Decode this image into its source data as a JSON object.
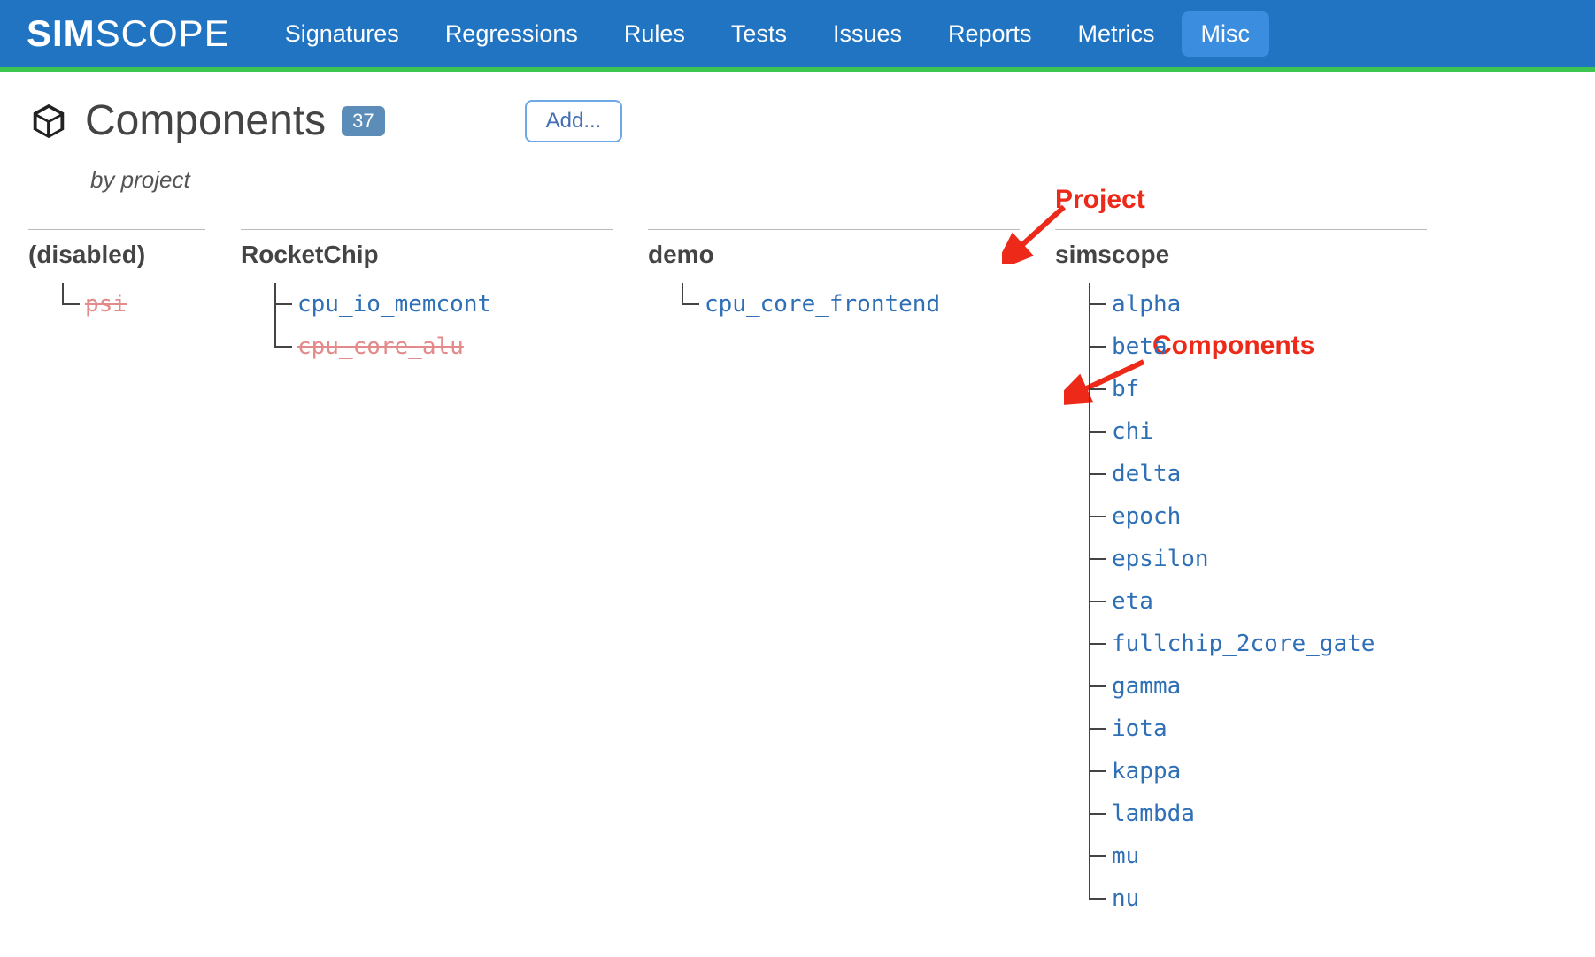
{
  "brand": {
    "part1": "SIM",
    "part2": "SCOPE"
  },
  "nav": [
    {
      "label": "Signatures",
      "active": false
    },
    {
      "label": "Regressions",
      "active": false
    },
    {
      "label": "Rules",
      "active": false
    },
    {
      "label": "Tests",
      "active": false
    },
    {
      "label": "Issues",
      "active": false
    },
    {
      "label": "Reports",
      "active": false
    },
    {
      "label": "Metrics",
      "active": false
    },
    {
      "label": "Misc",
      "active": true
    }
  ],
  "page": {
    "title": "Components",
    "count": "37",
    "add_label": "Add...",
    "subtitle": "by project"
  },
  "columns": [
    {
      "header": "(disabled)",
      "items": [
        {
          "label": "psi",
          "disabled": true
        }
      ]
    },
    {
      "header": "RocketChip",
      "items": [
        {
          "label": "cpu_io_memcont",
          "disabled": false
        },
        {
          "label": "cpu_core_alu",
          "disabled": true
        }
      ]
    },
    {
      "header": "demo",
      "items": [
        {
          "label": "cpu_core_frontend",
          "disabled": false
        }
      ]
    },
    {
      "header": "simscope",
      "items": [
        {
          "label": "alpha",
          "disabled": false
        },
        {
          "label": "beta",
          "disabled": false
        },
        {
          "label": "bf",
          "disabled": false
        },
        {
          "label": "chi",
          "disabled": false
        },
        {
          "label": "delta",
          "disabled": false
        },
        {
          "label": "epoch",
          "disabled": false
        },
        {
          "label": "epsilon",
          "disabled": false
        },
        {
          "label": "eta",
          "disabled": false
        },
        {
          "label": "fullchip_2core_gate",
          "disabled": false
        },
        {
          "label": "gamma",
          "disabled": false
        },
        {
          "label": "iota",
          "disabled": false
        },
        {
          "label": "kappa",
          "disabled": false
        },
        {
          "label": "lambda",
          "disabled": false
        },
        {
          "label": "mu",
          "disabled": false
        },
        {
          "label": "nu",
          "disabled": false
        }
      ]
    }
  ],
  "annotations": {
    "project_label": "Project",
    "components_label": "Components"
  }
}
